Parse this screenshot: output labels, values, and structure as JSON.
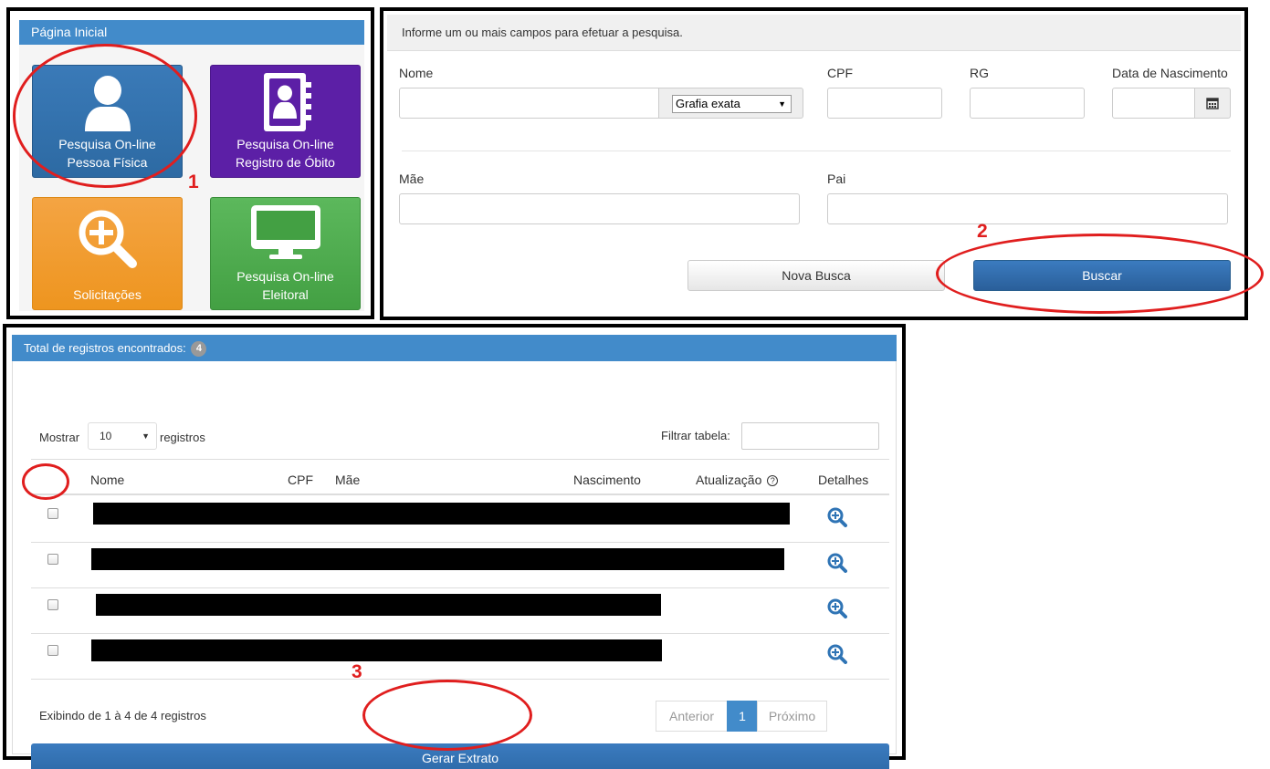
{
  "home_panel": {
    "title": "Página Inicial",
    "tiles": [
      {
        "line1": "Pesquisa On-line",
        "line2": "Pessoa Física",
        "icon": "person-icon",
        "color": "#2d6aa3"
      },
      {
        "line1": "Pesquisa On-line",
        "line2": "Registro de Óbito",
        "icon": "address-book-icon",
        "color": "#5c1fa6"
      },
      {
        "line1": "Solicitações",
        "line2": "",
        "icon": "search-plus-icon",
        "color": "#ee951f"
      },
      {
        "line1": "Pesquisa On-line",
        "line2": "Eleitoral",
        "icon": "monitor-icon",
        "color": "#43a043"
      }
    ]
  },
  "search_form": {
    "header": "Informe um ou mais campos para efetuar a pesquisa.",
    "labels": {
      "nome": "Nome",
      "cpf": "CPF",
      "rg": "RG",
      "nascimento": "Data de Nascimento",
      "mae": "Mãe",
      "pai": "Pai"
    },
    "grafia_option": "Grafia exata",
    "buttons": {
      "new_search": "Nova Busca",
      "search": "Buscar"
    }
  },
  "results": {
    "header_label": "Total de registros encontrados:",
    "count": "4",
    "show_label": "Mostrar",
    "page_length": "10",
    "records_label": "registros",
    "filter_label": "Filtrar tabela:",
    "columns": {
      "nome": "Nome",
      "cpf": "CPF",
      "mae": "Mãe",
      "nascimento": "Nascimento",
      "atualizacao": "Atualização",
      "detalhes": "Detalhes"
    },
    "row_count": 4,
    "info": "Exibindo de 1 à 4 de 4 registros",
    "pagination": {
      "previous": "Anterior",
      "current": "1",
      "next": "Próximo"
    },
    "extract_button": "Gerar Extrato"
  },
  "annotations": {
    "step1": "1",
    "step2": "2",
    "step3": "3",
    "color": "#e01e1e"
  }
}
